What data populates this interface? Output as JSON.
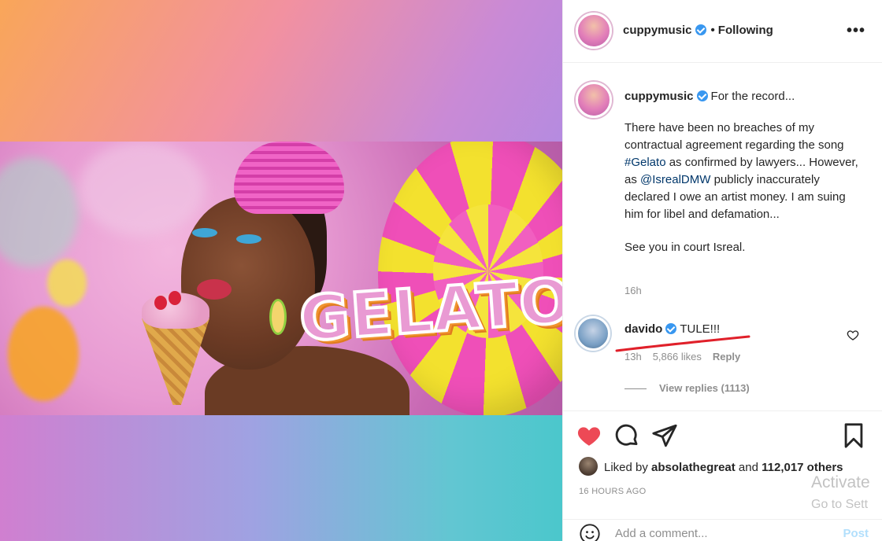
{
  "post": {
    "header": {
      "username": "cuppymusic",
      "separator": "•",
      "following_label": "Following",
      "more_icon": "•••"
    },
    "caption": {
      "username": "cuppymusic",
      "title": "For the record...",
      "body_part1": "There have been no breaches of my contractual agreement regarding the song ",
      "hashtag": "#Gelato",
      "body_part2": " as confirmed by lawyers... However, as ",
      "mention": "@IsrealDMW",
      "body_part3": " publicly inaccurately declared I owe an artist money. I am suing him for libel and defamation...",
      "signoff": "See you in court Isreal.",
      "time": "16h"
    },
    "comment": {
      "username": "davido",
      "text": "TULE!!!",
      "time": "13h",
      "likes": "5,866 likes",
      "reply_label": "Reply",
      "view_replies": "View replies (1113)"
    },
    "actions": {
      "liked_by_prefix": "Liked by",
      "liked_by_user": "absolathegreat",
      "liked_by_joiner": "and",
      "others": "112,017 others",
      "timestamp": "16 HOURS AGO"
    },
    "add_comment": {
      "placeholder": "Add a comment...",
      "post_label": "Post"
    }
  },
  "media": {
    "overlay_text": "GELATO"
  },
  "watermark": {
    "line1": "Activate",
    "line2": "Go to Sett"
  },
  "colors": {
    "verified": "#3897f0",
    "like_red": "#ed4956",
    "link": "#00376b",
    "underline_red": "#e0202a"
  }
}
